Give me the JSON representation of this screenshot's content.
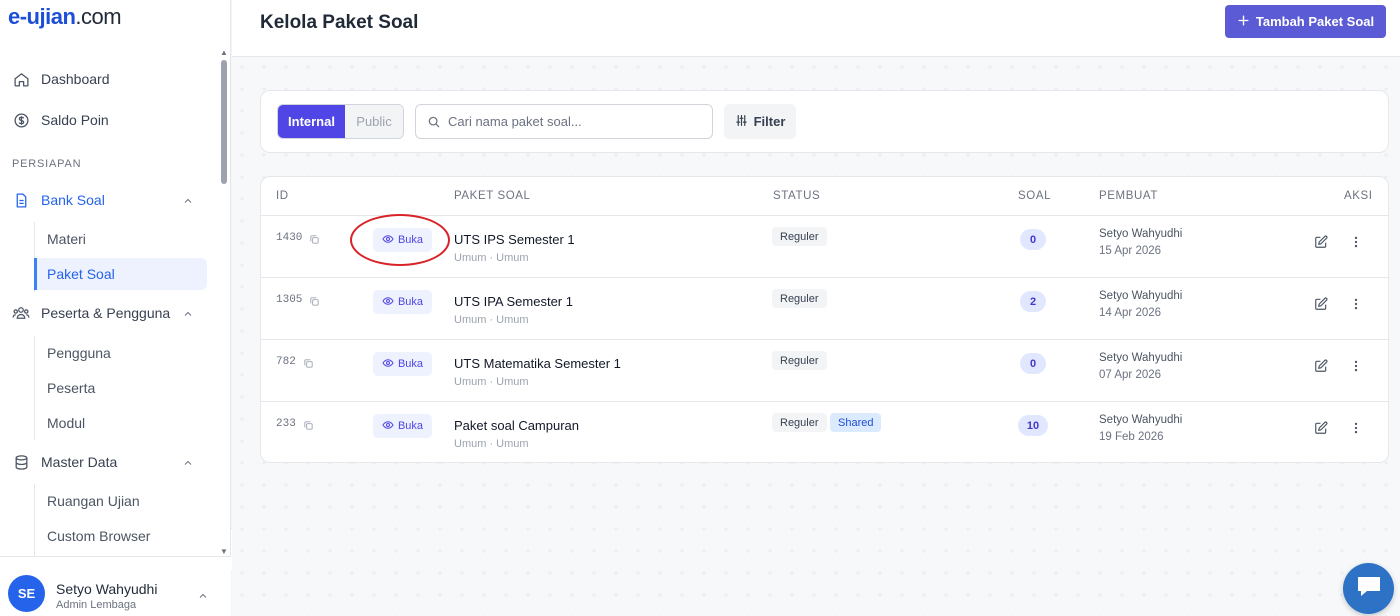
{
  "app": {
    "logo_main": "e-ujian",
    "logo_dom": ".com"
  },
  "sidebar": {
    "items": [
      {
        "label": "Dashboard",
        "icon": "home-icon"
      },
      {
        "label": "Saldo Poin",
        "icon": "dollar-circle-icon"
      }
    ],
    "section_persiapan": "PERSIAPAN",
    "bank_soal": {
      "label": "Bank Soal",
      "icon": "document-icon",
      "children": [
        "Materi",
        "Paket Soal"
      ]
    },
    "peserta_pengguna": {
      "label": "Peserta & Pengguna",
      "icon": "users-icon",
      "children": [
        "Pengguna",
        "Peserta",
        "Modul"
      ]
    },
    "master_data": {
      "label": "Master Data",
      "icon": "database-icon",
      "children": [
        "Ruangan Ujian",
        "Custom Browser"
      ]
    }
  },
  "user": {
    "initials": "SE",
    "name": "Setyo Wahyudhi",
    "role": "Admin Lembaga"
  },
  "header": {
    "title": "Kelola Paket Soal",
    "add_button": "Tambah Paket Soal"
  },
  "filters": {
    "tab_internal": "Internal",
    "tab_public": "Public",
    "search_placeholder": "Cari nama paket soal...",
    "filter_button": "Filter"
  },
  "table": {
    "columns": {
      "id": "ID",
      "paket": "PAKET SOAL",
      "status": "STATUS",
      "soal": "SOAL",
      "pembuat": "PEMBUAT",
      "aksi": "AKSI"
    },
    "open_label": "Buka",
    "rows": [
      {
        "id": "1430",
        "name": "UTS IPS Semester 1",
        "meta": "Umum · Umum",
        "status": "Reguler",
        "shared": "",
        "soal": "0",
        "author": "Setyo Wahyudhi",
        "date": "15 Apr 2026"
      },
      {
        "id": "1305",
        "name": "UTS IPA Semester 1",
        "meta": "Umum · Umum",
        "status": "Reguler",
        "shared": "",
        "soal": "2",
        "author": "Setyo Wahyudhi",
        "date": "14 Apr 2026"
      },
      {
        "id": "782",
        "name": "UTS Matematika Semester 1",
        "meta": "Umum · Umum",
        "status": "Reguler",
        "shared": "",
        "soal": "0",
        "author": "Setyo Wahyudhi",
        "date": "07 Apr 2026"
      },
      {
        "id": "233",
        "name": "Paket soal Campuran",
        "meta": "Umum · Umum",
        "status": "Reguler",
        "shared": "Shared",
        "soal": "10",
        "author": "Setyo Wahyudhi",
        "date": "19 Feb 2026"
      }
    ]
  },
  "colors": {
    "primary": "#4f46e5",
    "accent": "#2563eb",
    "highlight": "#d9222a"
  }
}
